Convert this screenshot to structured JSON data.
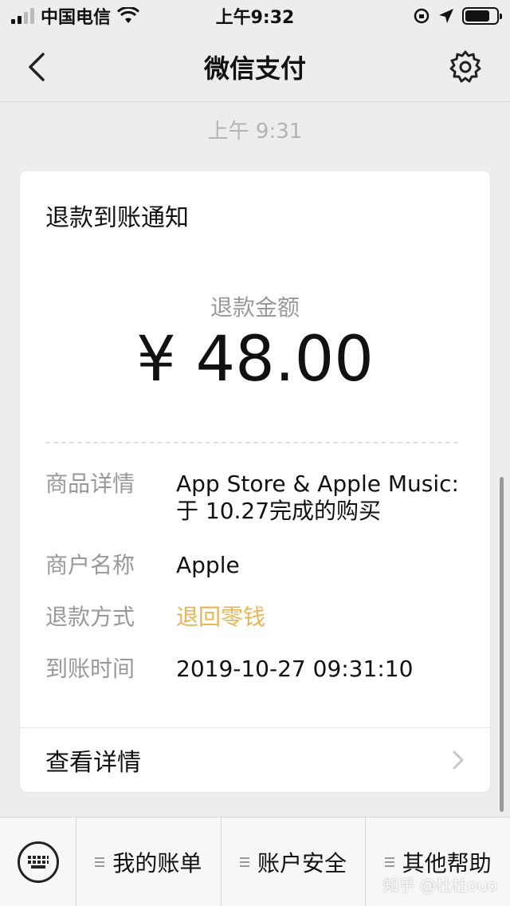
{
  "status_bar": {
    "carrier": "中国电信",
    "time": "上午9:32"
  },
  "nav": {
    "title": "微信支付"
  },
  "message": {
    "time": "上午 9:31"
  },
  "card": {
    "title": "退款到账通知",
    "amount_label": "退款金额",
    "amount_value": "¥ 48.00",
    "rows": [
      {
        "key": "商品详情",
        "value_line1": "App Store & Apple Music:",
        "value_line2": "于 10.27完成的购买"
      },
      {
        "key": "商户名称",
        "value": "Apple"
      },
      {
        "key": "退款方式",
        "value": "退回零钱"
      },
      {
        "key": "到账时间",
        "value": "2019-10-27 09:31:10"
      }
    ],
    "detail_link": "查看详情",
    "highlight_color": "#e8b454"
  },
  "bottom_menu": {
    "items": [
      {
        "label": "我的账单"
      },
      {
        "label": "账户安全"
      },
      {
        "label": "其他帮助"
      }
    ]
  },
  "watermark": "知乎 @杜杜ouo",
  "icons": {
    "back": "chevron-left-icon",
    "settings": "gear-icon",
    "keyboard": "keyboard-icon",
    "menu": "menu-lines-icon",
    "more": "chevron-right-icon"
  }
}
